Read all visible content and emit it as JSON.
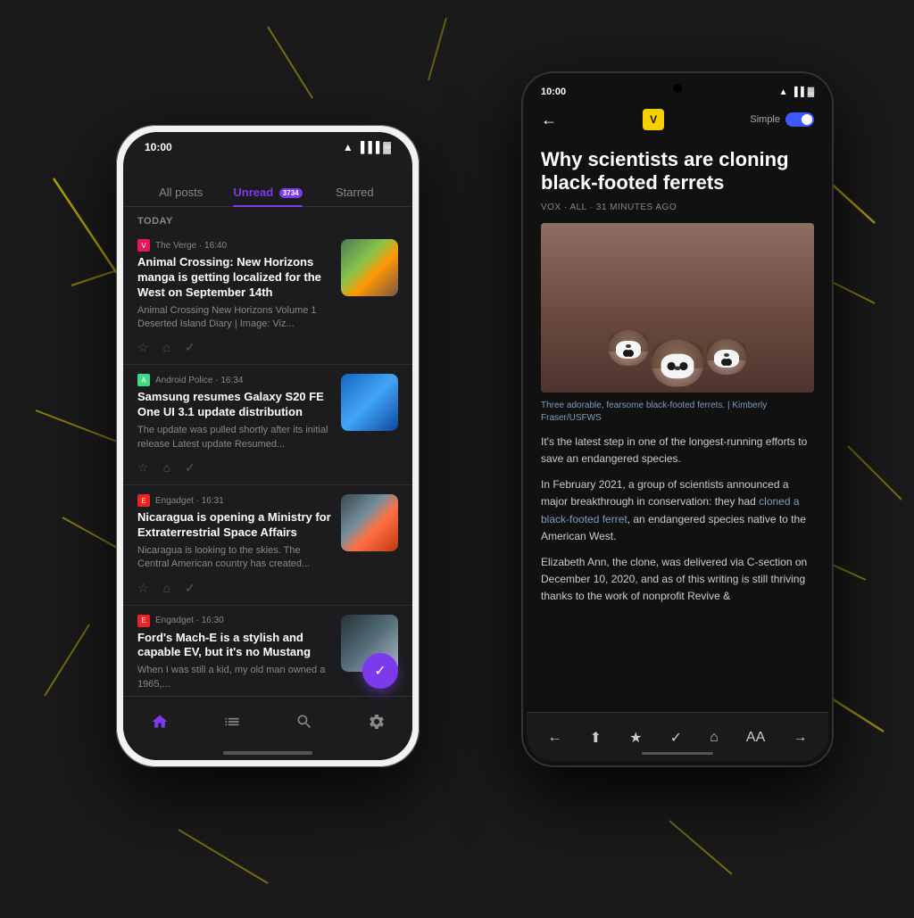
{
  "background": {
    "color": "#1a1a1a"
  },
  "iphone": {
    "status_time": "10:00",
    "tabs": [
      {
        "label": "All posts",
        "active": false
      },
      {
        "label": "Unread",
        "active": true,
        "badge": "3734"
      },
      {
        "label": "Starred",
        "active": false
      }
    ],
    "section_label": "TODAY",
    "feed_items": [
      {
        "source": "The Verge",
        "source_type": "verge",
        "time": "16:40",
        "title": "Animal Crossing: New Horizons manga is getting localized for the West on September 14th",
        "excerpt": "Animal Crossing New Horizons Volume 1 Deserted Island Diary | Image: Viz...",
        "has_thumb": true,
        "thumb_type": "animal"
      },
      {
        "source": "Android Police",
        "source_type": "android",
        "time": "16:34",
        "title": "Samsung resumes Galaxy S20 FE One UI 3.1 update distribution",
        "excerpt": "The update was pulled shortly after its initial release        Latest update Resumed...",
        "has_thumb": true,
        "thumb_type": "samsung"
      },
      {
        "source": "Engadget",
        "source_type": "engadget",
        "time": "16:31",
        "title": "Nicaragua is opening a Ministry for Extraterrestrial Space Affairs",
        "excerpt": "Nicaragua is looking to the skies. The Central American country has created...",
        "has_thumb": true,
        "thumb_type": "nicaragua"
      },
      {
        "source": "Engadget",
        "source_type": "engadget",
        "time": "16:30",
        "title": "Ford's Mach-E is a stylish and capable EV, but it's no Mustang",
        "excerpt": "When I was still a kid, my old man owned a 1965,...",
        "has_thumb": true,
        "thumb_type": "ford"
      }
    ],
    "bottom_nav": [
      "home",
      "list",
      "search",
      "settings"
    ]
  },
  "android": {
    "status_time": "10:00",
    "back_label": "←",
    "logo_letter": "V",
    "simple_label": "Simple",
    "header_label": "Why scientists are cloning black-footed ferrets",
    "article_meta": "VOX · ALL · 31 MINUTES AGO",
    "image_caption": "Three adorable, fearsome black-footed ferrets. | Kimberly Fraser/USFWS",
    "body_paragraph1": "It's the latest step in one of the longest-running efforts to save an endangered species.",
    "body_paragraph2": "In February 2021, a group of scientists announced a major breakthrough in conservation: they had cloned a black-footed ferret, an endangered species native to the American West.",
    "body_paragraph3": "Elizabeth Ann, the clone, was delivered via C-section on December 10, 2020, and as of this writing is still thriving thanks to the work of nonprofit Revive &",
    "bottom_bar_icons": [
      "←",
      "share",
      "★",
      "✓",
      "tag",
      "AA",
      "→"
    ]
  }
}
